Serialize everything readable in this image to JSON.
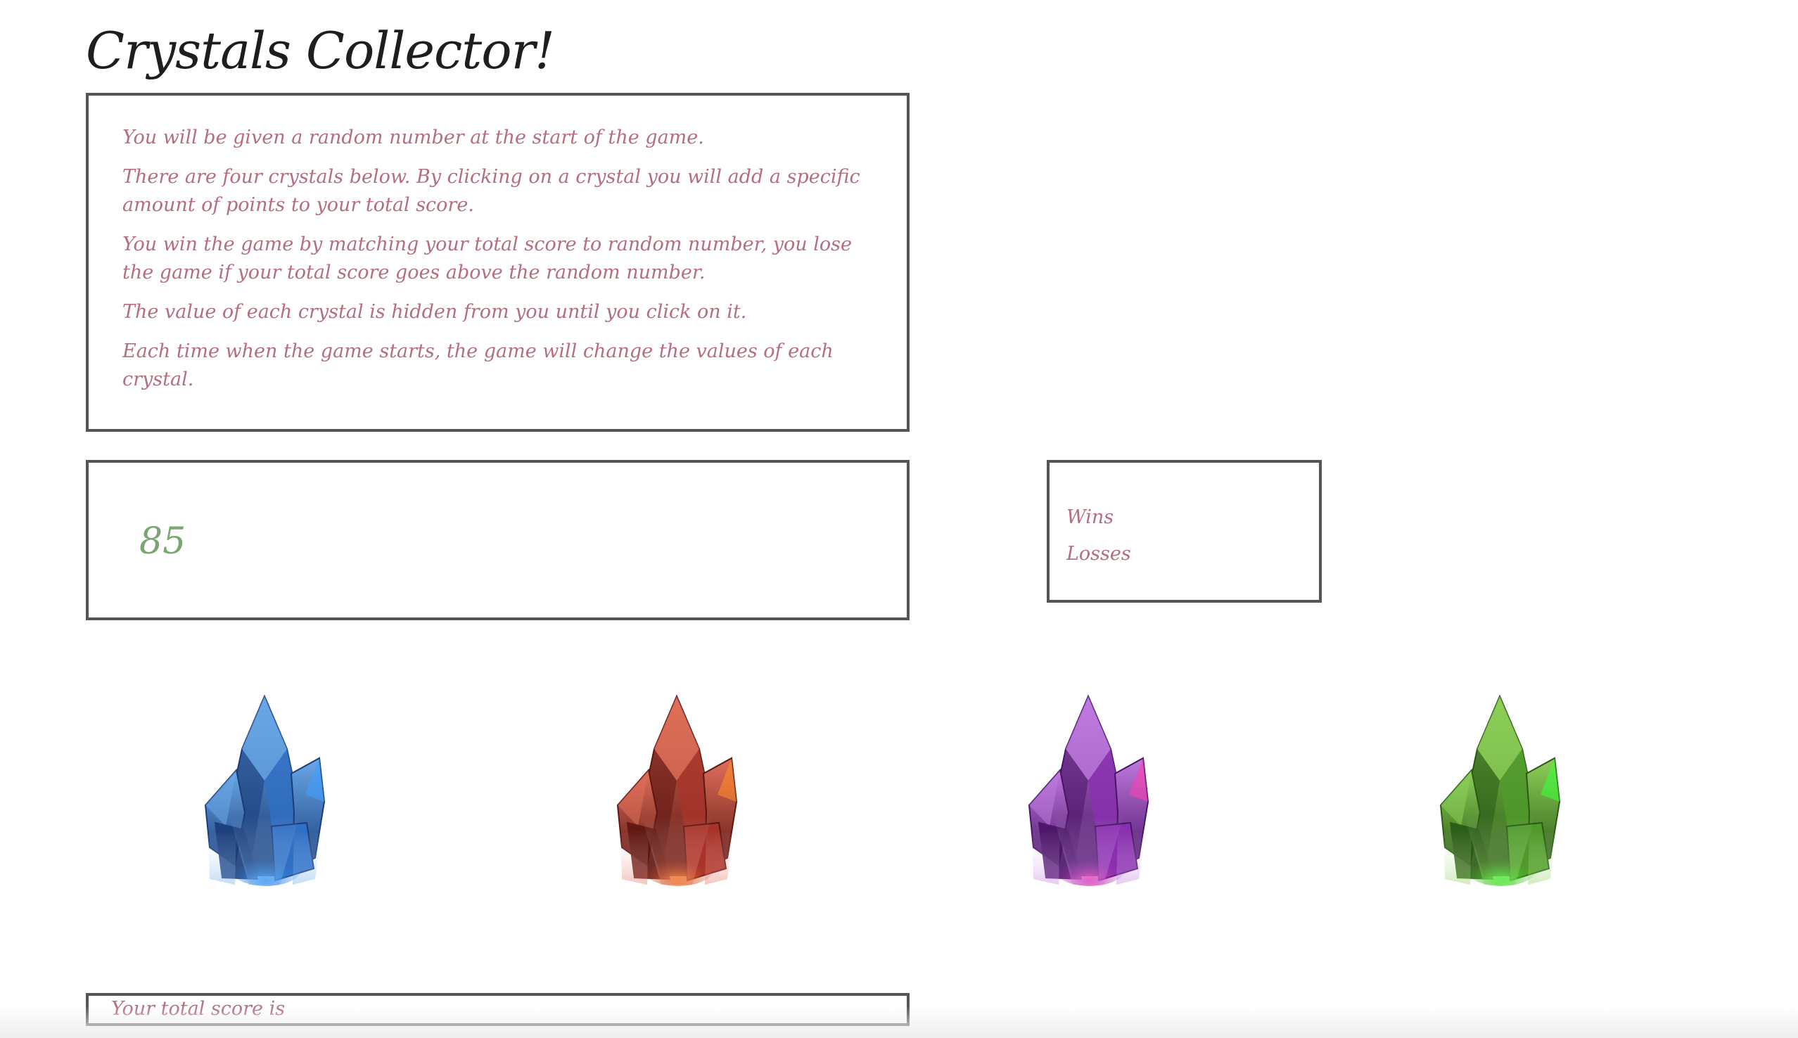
{
  "title": "Crystals Collector!",
  "instructions": [
    "You will be given a random number at the start of the game.",
    "There are four crystals below. By clicking on a crystal you will add a specific amount of points to your total score.",
    "You win the game by matching your total score to random number, you lose the game if your total score goes above the random number.",
    "The value of each crystal is hidden from you until you click on it.",
    "Each time when the game starts, the game will change the values of each crystal."
  ],
  "random_number": "85",
  "stats": {
    "wins_label": "Wins",
    "losses_label": "Losses"
  },
  "crystals": [
    {
      "name": "blue-crystal",
      "color": "#2f6fc4",
      "dark": "#1a3d7a",
      "light": "#6aa8e8",
      "glow": "#3fa0ff"
    },
    {
      "name": "red-crystal",
      "color": "#a8332a",
      "dark": "#5e1612",
      "light": "#e0705a",
      "glow": "#ff8a2a"
    },
    {
      "name": "purple-crystal",
      "color": "#8a2fb0",
      "dark": "#4a1466",
      "light": "#c07ae0",
      "glow": "#ff3fb0"
    },
    {
      "name": "green-crystal",
      "color": "#4f9a2a",
      "dark": "#2a5a14",
      "light": "#8ed05a",
      "glow": "#3aff3a"
    }
  ],
  "score": {
    "label": "Your total score is"
  }
}
